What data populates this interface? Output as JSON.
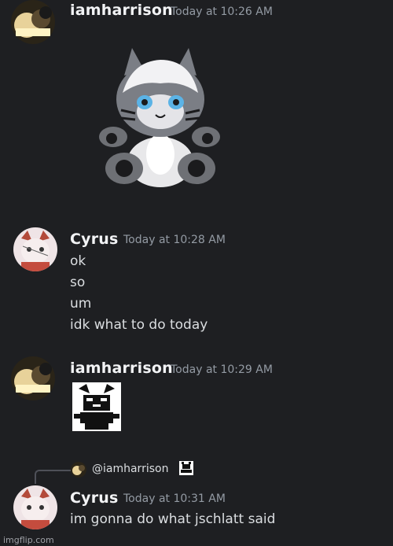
{
  "messages": [
    {
      "username": "iamharrison",
      "timestamp": "Today at 10:26 AM",
      "attachment": "plush-tiger-image"
    },
    {
      "username": "Cyrus",
      "timestamp": "Today at 10:28 AM",
      "lines": [
        "ok",
        "so",
        "um",
        "idk what to do today"
      ]
    },
    {
      "username": "iamharrison",
      "timestamp": "Today at 10:29 AM",
      "attachment": "cat-emoji-sticker"
    },
    {
      "reply_to": "@iamharrison",
      "username": "Cyrus",
      "timestamp": "Today at 10:31 AM",
      "lines": [
        "im gonna do what jschlatt said"
      ]
    }
  ],
  "watermark": "imgflip.com",
  "colors": {
    "background": "#1e1f22",
    "text": "#dbdee1",
    "username": "#f2f3f5",
    "timestamp": "#949ba4"
  }
}
